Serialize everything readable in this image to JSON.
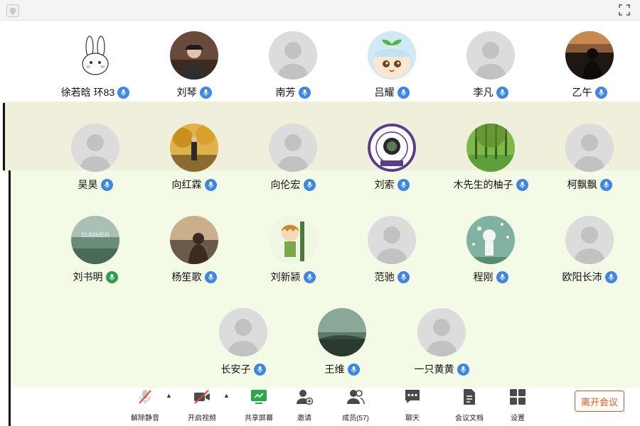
{
  "participants": [
    {
      "name": "徐若晗 环83",
      "avatar": "cartoon-rabbit"
    },
    {
      "name": "刘琴",
      "avatar": "photo"
    },
    {
      "name": "南芳",
      "avatar": "default"
    },
    {
      "name": "吕耀",
      "avatar": "cartoon-sprout"
    },
    {
      "name": "李凡",
      "avatar": "default"
    },
    {
      "name": "乙午",
      "avatar": "photo-sunset"
    },
    {
      "name": "吴昊",
      "avatar": "default"
    },
    {
      "name": "向红霖",
      "avatar": "photo-autumn"
    },
    {
      "name": "向伦宏",
      "avatar": "default"
    },
    {
      "name": "刘索",
      "avatar": "emblem"
    },
    {
      "name": "木先生的柚子",
      "avatar": "photo-forest"
    },
    {
      "name": "柯飘飘",
      "avatar": "default"
    },
    {
      "name": "刘书明",
      "avatar": "photo-sky"
    },
    {
      "name": "杨笙歌",
      "avatar": "photo-sunset-sea"
    },
    {
      "name": "刘新颍",
      "avatar": "cartoon-boy"
    },
    {
      "name": "范驰",
      "avatar": "default"
    },
    {
      "name": "程刚",
      "avatar": "cartoon-night"
    },
    {
      "name": "欧阳长沛",
      "avatar": "default"
    },
    {
      "name": "长安子",
      "avatar": "default"
    },
    {
      "name": "王维",
      "avatar": "photo-dark"
    },
    {
      "name": "一只黄黄",
      "avatar": "default"
    }
  ],
  "toolbar": {
    "unmute": "解除静音",
    "start_video": "开启视频",
    "share_screen": "共享屏幕",
    "invite": "邀请",
    "members": "成员(57)",
    "chat": "聊天",
    "meeting_docs": "会议文档",
    "settings": "设置"
  },
  "leave_meeting": "离开会议",
  "colors": {
    "mic": "#3d86e6",
    "mic_active": "#2a9d4a",
    "leave": "#e05a1a",
    "share_green": "#2aa94a"
  }
}
